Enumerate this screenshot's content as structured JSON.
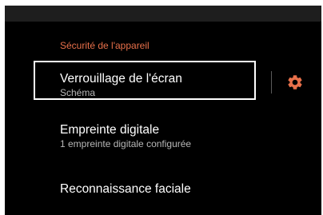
{
  "section": {
    "header": "Sécurité de l'appareil"
  },
  "items": [
    {
      "title": "Verrouillage de l'écran",
      "summary": "Schéma"
    },
    {
      "title": "Empreinte digitale",
      "summary": "1 empreinte digitale configurée"
    },
    {
      "title": "Reconnaissance faciale"
    }
  ],
  "icons": {
    "settings": "gear-icon"
  },
  "colors": {
    "accent": "#e8704a",
    "background": "#000000",
    "text_primary": "#ffffff",
    "text_secondary": "#b8b8b8"
  }
}
